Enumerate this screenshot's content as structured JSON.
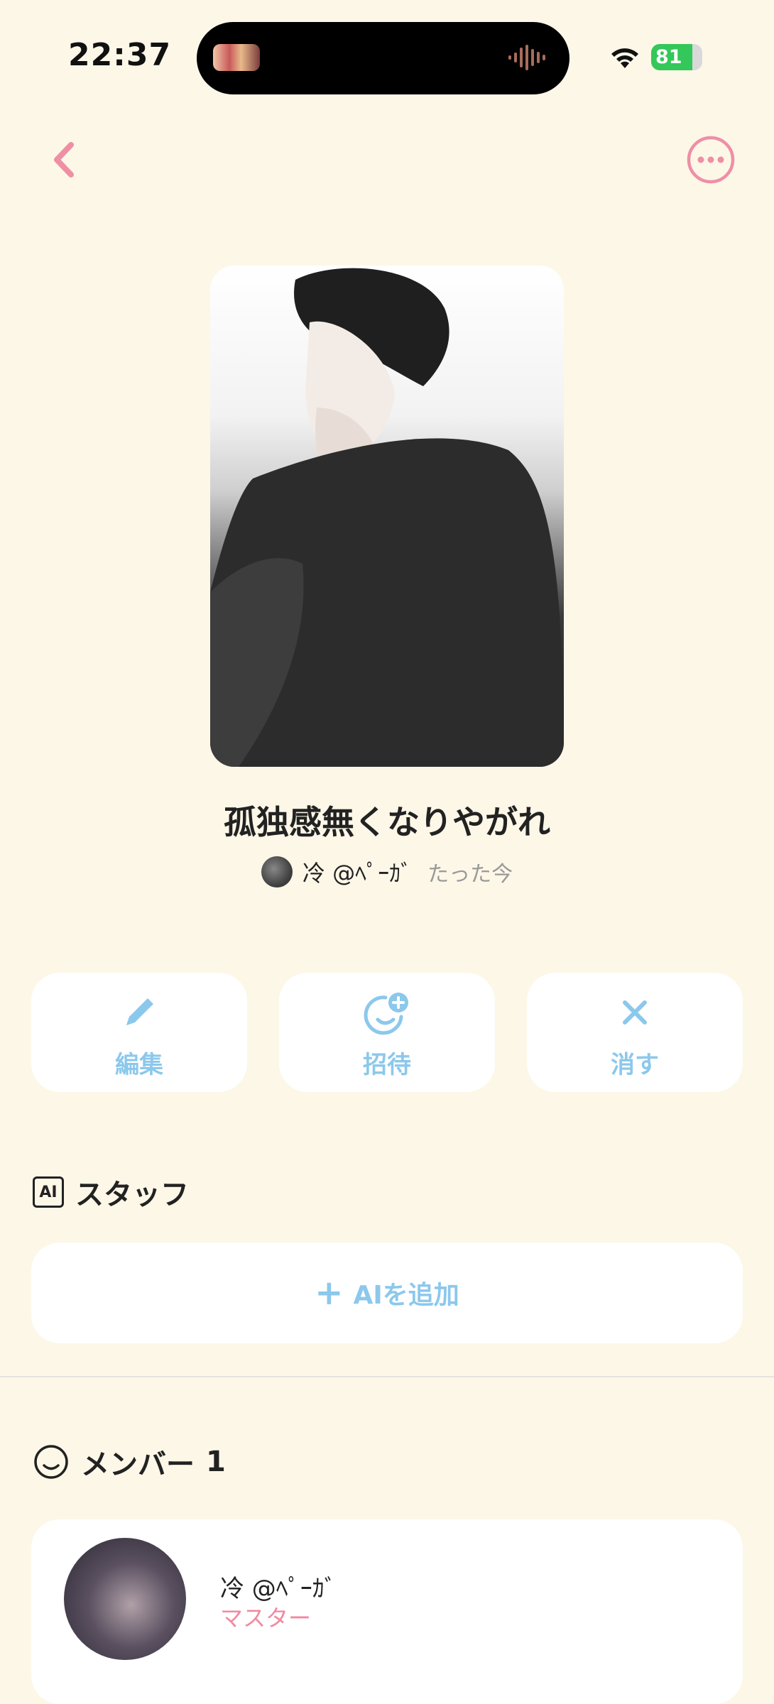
{
  "status_bar": {
    "time": "22:37",
    "battery": "81",
    "battery_level": 0.81
  },
  "nav": {
    "back_icon": "chevron-left-icon",
    "more_icon": "ellipsis-circle-icon",
    "accent_color": "#ee8fa5"
  },
  "group": {
    "title": "孤独感無くなりやがれ",
    "owner_name": "冷 @ﾍﾟｰｶﾞ",
    "timestamp": "たった今"
  },
  "actions": [
    {
      "label": "編集",
      "icon": "pencil-icon"
    },
    {
      "label": "招待",
      "icon": "smile-add-icon"
    },
    {
      "label": "消す",
      "icon": "close-icon"
    }
  ],
  "staff": {
    "badge": "AI",
    "heading": "スタッフ",
    "add_label": "AIを追加"
  },
  "members": {
    "heading": "メンバー",
    "count": "1",
    "items": [
      {
        "name": "冷 @ﾍﾟｰｶﾞ",
        "role": "マスター"
      }
    ]
  },
  "colors": {
    "background": "#fdf7e8",
    "action_blue": "#8cc8ec",
    "role_pink": "#f08aa2"
  }
}
